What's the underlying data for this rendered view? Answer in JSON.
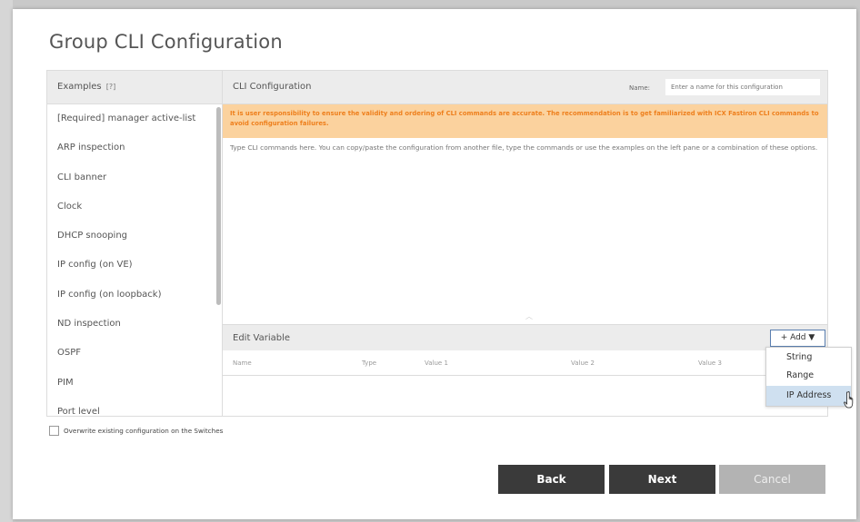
{
  "dialog": {
    "title": "Group CLI Configuration"
  },
  "examples": {
    "header": "Examples",
    "help": "[?]",
    "items": [
      "[Required] manager active-list",
      "ARP inspection",
      "CLI banner",
      "Clock",
      "DHCP snooping",
      "IP config (on VE)",
      "IP config (on loopback)",
      "ND inspection",
      "OSPF",
      "PIM",
      "Port level"
    ]
  },
  "cli": {
    "header": "CLI Configuration",
    "name_label": "Name:",
    "name_placeholder": "Enter a name for this configuration",
    "warning": "It is user responsibility to ensure the validity and ordering of CLI commands are accurate. The recommendation is to get familiarized with ICX Fastiron CLI commands to avoid configuration failures.",
    "placeholder": "Type CLI commands here. You can copy/paste the configuration from another file, type the commands or use the examples on the left pane or a combination of these options."
  },
  "edit_variable": {
    "header": "Edit Variable",
    "add_label": "+ Add ▼",
    "columns": [
      "Name",
      "Type",
      "Value 1",
      "Value 2",
      "Value 3"
    ],
    "menu": [
      "String",
      "Range",
      "IP Address"
    ],
    "menu_active": "IP Address"
  },
  "footer": {
    "overwrite_label": "Overwrite existing configuration on the Switches",
    "back": "Back",
    "next": "Next",
    "cancel": "Cancel"
  },
  "colors": {
    "warning_bg": "#fbd29e",
    "warning_text": "#ee7f1c",
    "primary_button": "#3a3a3a",
    "disabled_button": "#b3b3b3"
  },
  "icons": {
    "pointer": "hand-pointer-icon",
    "dropdown": "caret-down-icon"
  }
}
